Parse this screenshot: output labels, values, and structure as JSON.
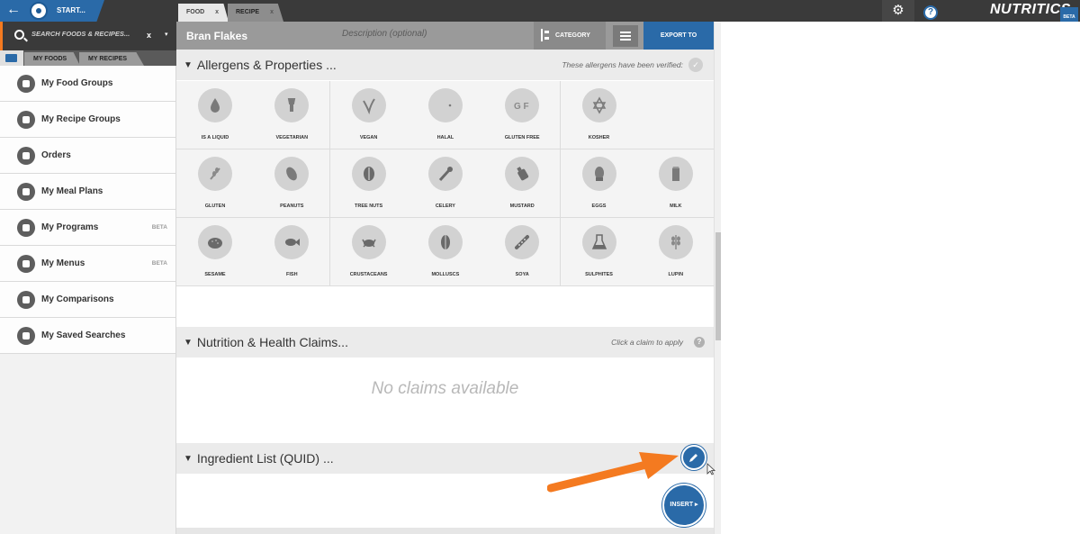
{
  "topbar": {
    "back_icon": "arrow-left-icon",
    "start_label": "START...",
    "tabs": [
      {
        "label": "FOOD",
        "close": "x"
      },
      {
        "label": "RECIPE",
        "close": "x"
      }
    ],
    "gear_icon": "gear-icon",
    "help_icon": "?",
    "logo": "NUTRITICS",
    "logo_badge": "BETA"
  },
  "sidebar": {
    "search_placeholder": "SEARCH FOODS & RECIPES...",
    "search_clear": "x",
    "search_dropdown": "▾",
    "subtabs": [
      "MY FOODS",
      "MY RECIPES"
    ],
    "items": [
      {
        "label": "My Food Groups",
        "icon": "apple-icon",
        "badge": ""
      },
      {
        "label": "My Recipe Groups",
        "icon": "chef-hat-icon",
        "badge": ""
      },
      {
        "label": "Orders",
        "icon": "document-icon",
        "badge": ""
      },
      {
        "label": "My Meal Plans",
        "icon": "meal-plan-icon",
        "badge": ""
      },
      {
        "label": "My Programs",
        "icon": "program-icon",
        "badge": "BETA"
      },
      {
        "label": "My Menus",
        "icon": "cutlery-icon",
        "badge": "BETA"
      },
      {
        "label": "My Comparisons",
        "icon": "scales-icon",
        "badge": ""
      },
      {
        "label": "My Saved Searches",
        "icon": "search-icon",
        "badge": ""
      }
    ]
  },
  "main": {
    "food_name": "Bran Flakes",
    "description_placeholder": "Description (optional)",
    "category_label": "CATEGORY",
    "export_label": "EXPORT TO",
    "allergens": {
      "title": "Allergens & Properties ...",
      "note": "These allergens have been verified:",
      "items": [
        {
          "label": "IS A LIQUID",
          "icon": "liquid-drop-icon"
        },
        {
          "label": "VEGETARIAN",
          "icon": "vegetarian-icon"
        },
        {
          "label": "VEGAN",
          "icon": "vegan-icon"
        },
        {
          "label": "HALAL",
          "icon": "halal-icon"
        },
        {
          "label": "GLUTEN FREE",
          "icon": "gluten-free-icon"
        },
        {
          "label": "KOSHER",
          "icon": "kosher-icon"
        },
        {
          "label": "GLUTEN",
          "icon": "wheat-icon"
        },
        {
          "label": "PEANUTS",
          "icon": "peanut-icon"
        },
        {
          "label": "TREE NUTS",
          "icon": "tree-nut-icon"
        },
        {
          "label": "CELERY",
          "icon": "celery-icon"
        },
        {
          "label": "MUSTARD",
          "icon": "mustard-icon"
        },
        {
          "label": "EGGS",
          "icon": "egg-icon"
        },
        {
          "label": "MILK",
          "icon": "milk-icon"
        },
        {
          "label": "SESAME",
          "icon": "sesame-icon"
        },
        {
          "label": "FISH",
          "icon": "fish-icon"
        },
        {
          "label": "CRUSTACEANS",
          "icon": "crab-icon"
        },
        {
          "label": "MOLLUSCS",
          "icon": "mollusc-icon"
        },
        {
          "label": "SOYA",
          "icon": "soya-icon"
        },
        {
          "label": "SULPHITES",
          "icon": "sulphites-icon"
        },
        {
          "label": "LUPIN",
          "icon": "lupin-icon"
        }
      ]
    },
    "claims": {
      "title": "Nutrition & Health Claims...",
      "note": "Click a claim to apply",
      "empty": "No claims available"
    },
    "ingredients": {
      "title": "Ingredient List (QUID) ..."
    },
    "insert_label": "INSERT ▸"
  },
  "colors": {
    "accent": "#2a6aa8",
    "arrow": "#f47a20",
    "topbar": "#3a3a3a"
  }
}
